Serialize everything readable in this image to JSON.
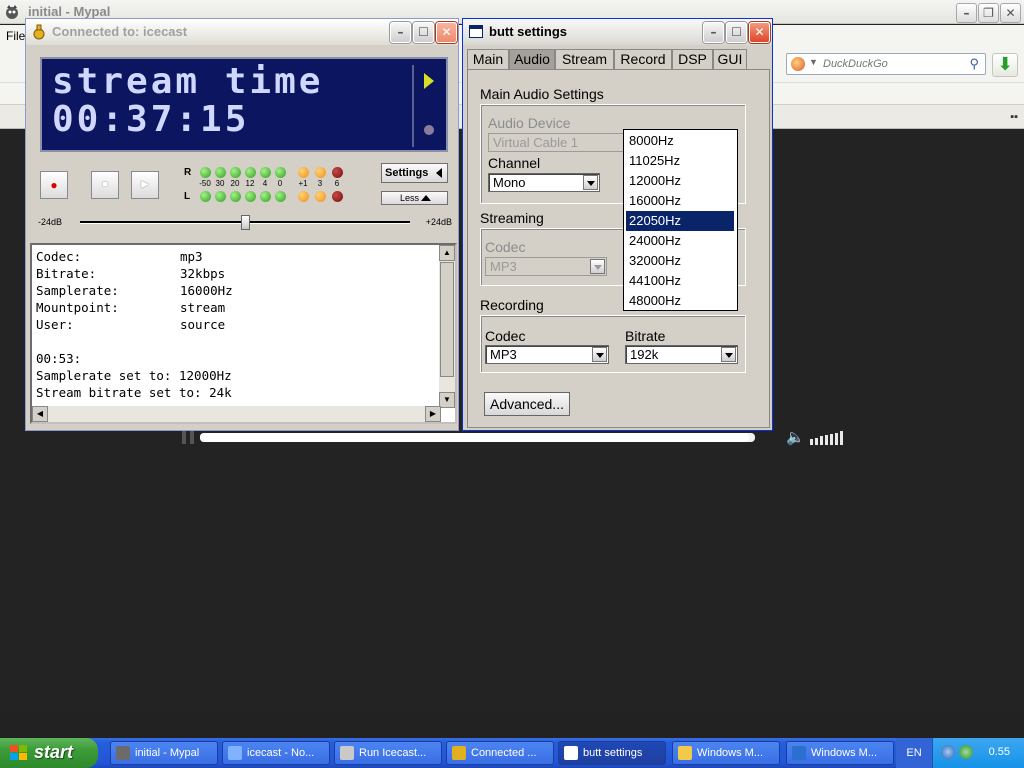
{
  "browser": {
    "title": "initial - Mypal",
    "menu_first": "File",
    "search_placeholder": "DuckDuckGo"
  },
  "player": {
    "seek_progress": 0.99
  },
  "butt_main": {
    "title": "Connected to: icecast",
    "lcd_line1": "stream time",
    "lcd_line2": "00:37:15",
    "vu_right_label": "R",
    "vu_left_label": "L",
    "vu_scale": [
      "-50",
      "30",
      "20",
      "12",
      "4",
      "0",
      "+1",
      "3",
      "6"
    ],
    "settings_label": "Settings",
    "less_label": "Less",
    "gain_min": "-24dB",
    "gain_max": "+24dB",
    "gain_level": 0.5,
    "log": {
      "fields": [
        {
          "key": "Codec:",
          "value": "mp3"
        },
        {
          "key": "Bitrate:",
          "value": "32kbps"
        },
        {
          "key": "Samplerate:",
          "value": "16000Hz"
        },
        {
          "key": "Mountpoint:",
          "value": "stream"
        },
        {
          "key": "User:",
          "value": "source"
        }
      ],
      "time": "00:53:",
      "msg1": "Samplerate set to: 12000Hz",
      "msg2": "Stream bitrate set to: 24k"
    }
  },
  "butt_settings": {
    "title": "butt settings",
    "tabs": [
      "Main",
      "Audio",
      "Stream",
      "Record",
      "DSP",
      "GUI"
    ],
    "selected_tab": "Audio",
    "main_audio_title": "Main Audio Settings",
    "audio_device_label": "Audio Device",
    "audio_device_value": "Virtual Cable 1",
    "channel_label": "Channel",
    "channel_value": "Mono",
    "streaming_title": "Streaming",
    "stream_codec_label": "Codec",
    "stream_codec_value": "MP3",
    "recording_title": "Recording",
    "rec_codec_label": "Codec",
    "rec_codec_value": "MP3",
    "rec_bitrate_label": "Bitrate",
    "rec_bitrate_value": "192k",
    "advanced_label": "Advanced...",
    "samplerate_options": [
      "8000Hz",
      "11025Hz",
      "12000Hz",
      "16000Hz",
      "22050Hz",
      "24000Hz",
      "32000Hz",
      "44100Hz",
      "48000Hz"
    ],
    "samplerate_selected_index": 4
  },
  "taskbar": {
    "start_label": "start",
    "tasks": [
      {
        "label": "initial - Mypal",
        "icon": "raccoon-icon",
        "color": "#6b6b6b"
      },
      {
        "label": "icecast - No...",
        "icon": "notepad-icon",
        "color": "#7fb2ff"
      },
      {
        "label": "Run Icecast...",
        "icon": "x-icon",
        "color": "#c9c9c9"
      },
      {
        "label": "Connected ...",
        "icon": "butt-icon",
        "color": "#e0b020"
      },
      {
        "label": "butt settings",
        "icon": "window-icon",
        "color": "#ffffff"
      },
      {
        "label": "Windows M...",
        "icon": "folder-icon",
        "color": "#f3c94a"
      },
      {
        "label": "Windows M...",
        "icon": "media-player-icon",
        "color": "#2a6fd1"
      }
    ],
    "active_task_index": 4,
    "language": "EN",
    "clock": "0.55"
  }
}
